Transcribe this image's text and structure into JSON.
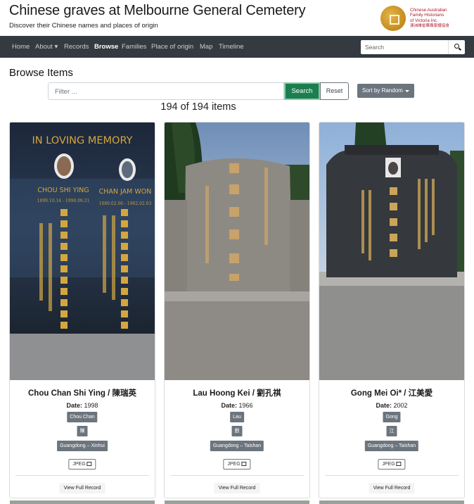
{
  "header": {
    "title": "Chinese graves at Melbourne General Cemetery",
    "subtitle": "Discover their Chinese names and places of origin",
    "logo_lines": [
      "Chinese Australian",
      "Family Historians",
      "of Victoria Inc.",
      "澳洲維省華裔家譜協會"
    ]
  },
  "nav": {
    "items": [
      "Home",
      "About",
      "Records",
      "Browse",
      "Families",
      "Place of origin",
      "Map",
      "Timeline"
    ],
    "active": "Browse",
    "search_placeholder": "Search"
  },
  "browse": {
    "heading": "Browse Items",
    "filter_placeholder": "Filter ...",
    "search_label": "Search",
    "reset_label": "Reset",
    "sort_label": "Sort by Random",
    "count": "194 of 194 items"
  },
  "cards": [
    {
      "title": "Chou Chan Shi Ying / 陳瑞英",
      "date_label": "Date:",
      "date": "1998",
      "family": "Chou Chan",
      "chinese_surname": "陳",
      "origin": "Guangdong – Xinhui",
      "format": "JPEG",
      "view_label": "View Full Record",
      "photo_text": {
        "banner": "IN LOVING MEMORY",
        "name_left": "CHOU SHI YING",
        "name_right": "CHAN JAM WON",
        "dates_left": "1899.10.14 - 1998.09.21",
        "dates_right": "1880.02.06 - 1962.02.03"
      }
    },
    {
      "title": "Lau Hoong Kei / 劉孔祺",
      "date_label": "Date:",
      "date": "1966",
      "family": "Lau",
      "chinese_surname": "劉",
      "origin": "Guangdong – Taishan",
      "format": "JPEG",
      "view_label": "View Full Record"
    },
    {
      "title": "Gong Mei Oi* / 江美愛",
      "date_label": "Date:",
      "date": "2002",
      "family": "Gong",
      "chinese_surname": "江",
      "origin": "Guangdong – Taishan",
      "format": "JPEG",
      "view_label": "View Full Record"
    }
  ],
  "colors": {
    "navbar": "#343a40",
    "search_button": "#1b7e4f",
    "badge": "#6c757d"
  }
}
